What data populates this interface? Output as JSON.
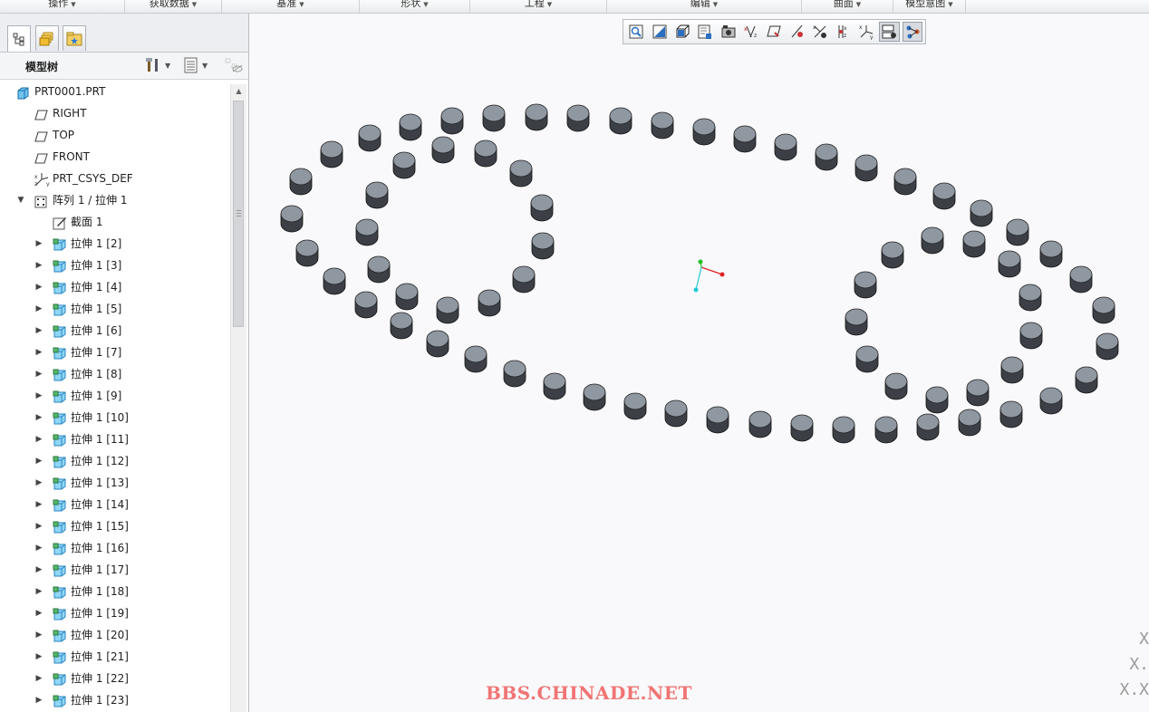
{
  "ribbon": {
    "groups": [
      {
        "label": "操作"
      },
      {
        "label": "获取数据"
      },
      {
        "label": "基准"
      },
      {
        "label": "形状"
      },
      {
        "label": "工程"
      },
      {
        "label": "编辑"
      },
      {
        "label": "曲面"
      },
      {
        "label": "模型意图"
      }
    ]
  },
  "panel": {
    "tabs": [
      {
        "icon": "model-tree-icon"
      },
      {
        "icon": "folder-browser-icon"
      },
      {
        "icon": "favorites-icon"
      }
    ],
    "tree_title": "模型树"
  },
  "tree": {
    "items": [
      {
        "label": "PRT0001.PRT",
        "icon": "part-icon",
        "level": 0,
        "expand": ""
      },
      {
        "label": "RIGHT",
        "icon": "datum-plane-icon",
        "level": 1,
        "expand": ""
      },
      {
        "label": "TOP",
        "icon": "datum-plane-icon",
        "level": 1,
        "expand": ""
      },
      {
        "label": "FRONT",
        "icon": "datum-plane-icon",
        "level": 1,
        "expand": ""
      },
      {
        "label": "PRT_CSYS_DEF",
        "icon": "csys-icon",
        "level": 1,
        "expand": ""
      },
      {
        "label": "阵列 1 / 拉伸 1",
        "icon": "pattern-icon",
        "level": 1,
        "expand": "open"
      },
      {
        "label": "截面 1",
        "icon": "sketch-icon",
        "level": 2,
        "expand": ""
      },
      {
        "label": "拉伸 1 [2]",
        "icon": "extrude-icon",
        "level": 2,
        "expand": "closed"
      },
      {
        "label": "拉伸 1 [3]",
        "icon": "extrude-icon",
        "level": 2,
        "expand": "closed"
      },
      {
        "label": "拉伸 1 [4]",
        "icon": "extrude-icon",
        "level": 2,
        "expand": "closed"
      },
      {
        "label": "拉伸 1 [5]",
        "icon": "extrude-icon",
        "level": 2,
        "expand": "closed"
      },
      {
        "label": "拉伸 1 [6]",
        "icon": "extrude-icon",
        "level": 2,
        "expand": "closed"
      },
      {
        "label": "拉伸 1 [7]",
        "icon": "extrude-icon",
        "level": 2,
        "expand": "closed"
      },
      {
        "label": "拉伸 1 [8]",
        "icon": "extrude-icon",
        "level": 2,
        "expand": "closed"
      },
      {
        "label": "拉伸 1 [9]",
        "icon": "extrude-icon",
        "level": 2,
        "expand": "closed"
      },
      {
        "label": "拉伸 1 [10]",
        "icon": "extrude-icon",
        "level": 2,
        "expand": "closed"
      },
      {
        "label": "拉伸 1 [11]",
        "icon": "extrude-icon",
        "level": 2,
        "expand": "closed"
      },
      {
        "label": "拉伸 1 [12]",
        "icon": "extrude-icon",
        "level": 2,
        "expand": "closed"
      },
      {
        "label": "拉伸 1 [13]",
        "icon": "extrude-icon",
        "level": 2,
        "expand": "closed"
      },
      {
        "label": "拉伸 1 [14]",
        "icon": "extrude-icon",
        "level": 2,
        "expand": "closed"
      },
      {
        "label": "拉伸 1 [15]",
        "icon": "extrude-icon",
        "level": 2,
        "expand": "closed"
      },
      {
        "label": "拉伸 1 [16]",
        "icon": "extrude-icon",
        "level": 2,
        "expand": "closed"
      },
      {
        "label": "拉伸 1 [17]",
        "icon": "extrude-icon",
        "level": 2,
        "expand": "closed"
      },
      {
        "label": "拉伸 1 [18]",
        "icon": "extrude-icon",
        "level": 2,
        "expand": "closed"
      },
      {
        "label": "拉伸 1 [19]",
        "icon": "extrude-icon",
        "level": 2,
        "expand": "closed"
      },
      {
        "label": "拉伸 1 [20]",
        "icon": "extrude-icon",
        "level": 2,
        "expand": "closed"
      },
      {
        "label": "拉伸 1 [21]",
        "icon": "extrude-icon",
        "level": 2,
        "expand": "closed"
      },
      {
        "label": "拉伸 1 [22]",
        "icon": "extrude-icon",
        "level": 2,
        "expand": "closed"
      },
      {
        "label": "拉伸 1 [23]",
        "icon": "extrude-icon",
        "level": 2,
        "expand": "closed"
      }
    ]
  },
  "view_toolbar": {
    "buttons": [
      {
        "icon": "refit-icon",
        "pressed": false
      },
      {
        "icon": "zoom-in-icon",
        "pressed": false
      },
      {
        "icon": "zoom-out-icon",
        "pressed": false
      },
      {
        "icon": "repaint-icon",
        "pressed": false
      },
      {
        "icon": "display-style-icon",
        "pressed": false
      },
      {
        "icon": "saved-orientations-icon",
        "pressed": false
      },
      {
        "icon": "view-manager-icon",
        "pressed": false
      },
      {
        "icon": "plane-display-icon",
        "pressed": false
      },
      {
        "icon": "axis-display-icon",
        "pressed": false
      },
      {
        "icon": "point-display-icon",
        "pressed": false
      },
      {
        "icon": "csys-display-icon",
        "pressed": false
      },
      {
        "icon": "spin-center-icon",
        "pressed": true
      },
      {
        "icon": "annotation-display-icon",
        "pressed": true
      }
    ]
  },
  "watermark": "BBS.CHINADE.NET",
  "corner_marks": [
    "X",
    "X.",
    "X.X"
  ],
  "colors": {
    "cylinder_top": "#8f97a1",
    "cylinder_side": "#3c4046",
    "axis_x": "#e02020",
    "axis_y": "#22c022",
    "axis_z": "#22c8d8"
  }
}
